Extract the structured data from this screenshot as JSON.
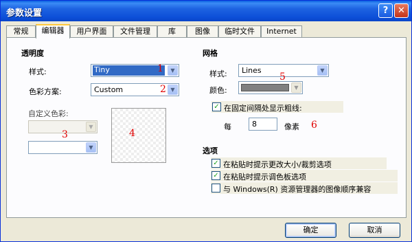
{
  "window": {
    "title": "参数设置",
    "help": "?",
    "close": "✕"
  },
  "tabs": [
    "常规",
    "编辑器",
    "用户界面",
    "文件管理",
    "库",
    "图像",
    "临时文件",
    "Internet"
  ],
  "transparency": {
    "heading": "透明度",
    "style_label": "样式:",
    "style_value": "Tiny",
    "scheme_label": "色彩方案:",
    "scheme_value": "Custom",
    "custom_label": "自定义色彩:"
  },
  "grid": {
    "heading": "网格",
    "style_label": "样式:",
    "style_value": "Lines",
    "color_label": "颜色:",
    "color_value": "#808080",
    "show_coarse_label": "在固定间隔处显示粗线:",
    "show_coarse_checked": true,
    "every_label": "每",
    "every_value": "8",
    "unit_label": "像素"
  },
  "options": {
    "heading": "选项",
    "items": [
      {
        "label": "在粘贴时提示更改大小/裁剪选项",
        "checked": true
      },
      {
        "label": "在粘贴时提示调色板选项",
        "checked": true
      },
      {
        "label": "与 Windows(R) 资源管理器的图像顺序兼容",
        "checked": false
      }
    ]
  },
  "annotations": [
    "1",
    "2",
    "3",
    "4",
    "5",
    "6"
  ],
  "buttons": {
    "ok": "确定",
    "cancel": "取消"
  },
  "icons": {
    "dropdown": "chevron-down-icon",
    "check": "check-icon"
  }
}
